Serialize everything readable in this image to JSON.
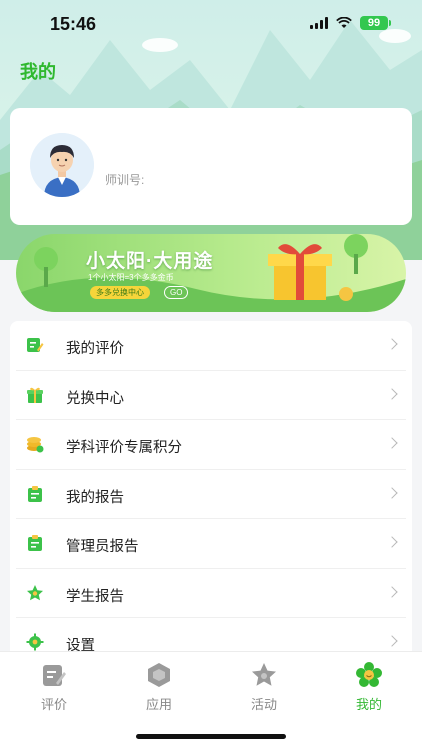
{
  "status_bar": {
    "time": "15:46",
    "battery": "99"
  },
  "header": {
    "title": "我的"
  },
  "profile": {
    "trainer_id_label": "师训号:"
  },
  "banner": {
    "title": "小太阳·大用途",
    "subtitle": "1个小太阳=3个多多金币",
    "pill": "多多兑换中心",
    "go": "GO"
  },
  "menu": {
    "items": [
      {
        "label": "我的评价",
        "icon": "review-icon"
      },
      {
        "label": "兑换中心",
        "icon": "gift-icon"
      },
      {
        "label": "学科评价专属积分",
        "icon": "coins-icon"
      },
      {
        "label": "我的报告",
        "icon": "report-icon"
      },
      {
        "label": "管理员报告",
        "icon": "report-icon"
      },
      {
        "label": "学生报告",
        "icon": "star-icon"
      },
      {
        "label": "设置",
        "icon": "gear-icon"
      }
    ]
  },
  "tabbar": {
    "tabs": [
      {
        "label": "评价",
        "icon": "evaluate-icon",
        "active": false
      },
      {
        "label": "应用",
        "icon": "apps-icon",
        "active": false
      },
      {
        "label": "活动",
        "icon": "activity-star-icon",
        "active": false
      },
      {
        "label": "我的",
        "icon": "flower-profile-icon",
        "active": true
      }
    ]
  },
  "colors": {
    "accent": "#34b834",
    "menu_icon_green": "#3cc24a",
    "coin_yellow": "#f5c542"
  }
}
